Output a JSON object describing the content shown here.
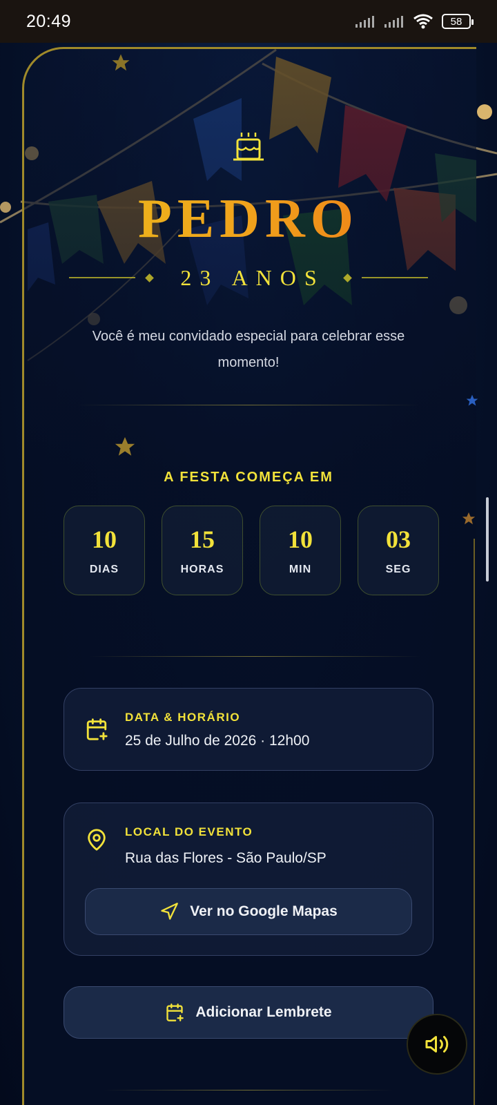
{
  "status_bar": {
    "time": "20:49",
    "battery": "58"
  },
  "hero": {
    "icon": "birthday-cake-icon",
    "name": "PEDRO",
    "age": "23 ANOS",
    "tagline": "Você é meu convidado especial para celebrar esse momento!"
  },
  "countdown": {
    "title": "A FESTA COMEÇA EM",
    "units": [
      {
        "value": "10",
        "label": "DIAS"
      },
      {
        "value": "15",
        "label": "HORAS"
      },
      {
        "value": "10",
        "label": "MIN"
      },
      {
        "value": "03",
        "label": "SEG"
      }
    ]
  },
  "date_card": {
    "icon": "calendar-plus-icon",
    "title": "DATA & HORÁRIO",
    "value": "25 de Julho de 2026 · 12h00"
  },
  "location_card": {
    "icon": "map-pin-icon",
    "title": "LOCAL DO EVENTO",
    "value": "Rua das Flores - São Paulo/SP",
    "maps_button": "Ver no Google Mapas",
    "maps_icon": "navigation-arrow-icon"
  },
  "reminder_button": {
    "label": "Adicionar Lembrete",
    "icon": "calendar-plus-icon"
  },
  "sound_button": {
    "icon": "speaker-volume-icon"
  },
  "colors": {
    "accent": "#f2e23a",
    "background": "#050d1f",
    "card_border": "#a08a2a"
  }
}
